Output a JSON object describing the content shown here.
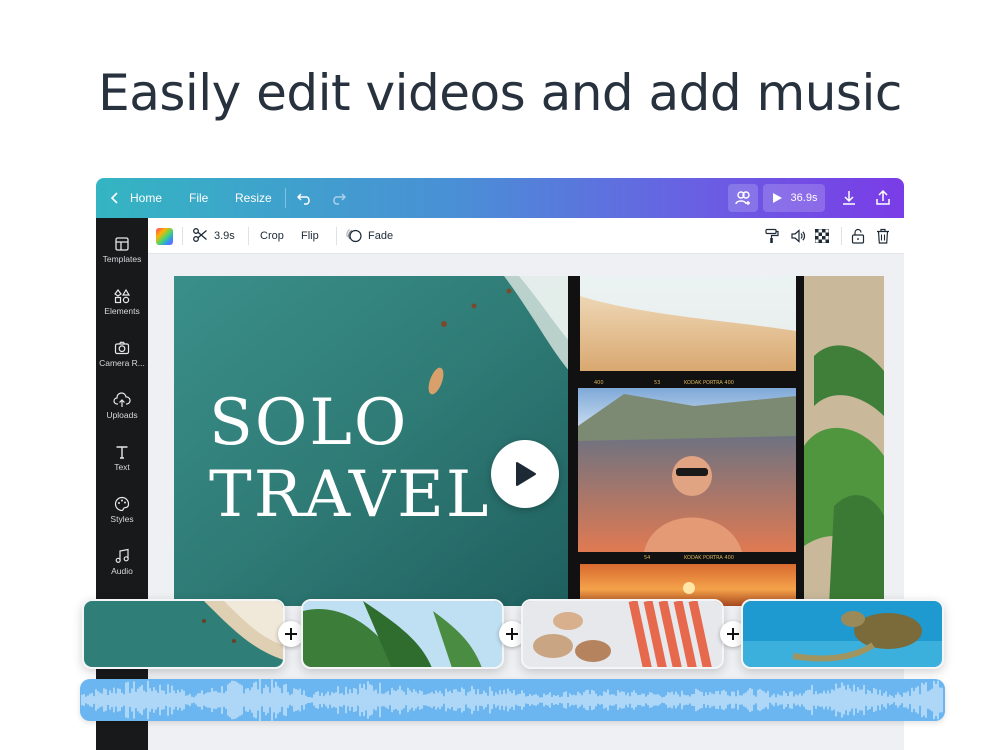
{
  "headline": "Easily edit videos and add music",
  "topbar": {
    "home_label": "Home",
    "file_label": "File",
    "resize_label": "Resize",
    "duration": "36.9s",
    "icons": [
      "chevron-left-icon",
      "undo-icon",
      "redo-icon",
      "share-people-icon",
      "play-icon",
      "download-icon",
      "upload-icon"
    ]
  },
  "sidebar": {
    "items": [
      {
        "label": "Templates",
        "icon": "templates-icon"
      },
      {
        "label": "Elements",
        "icon": "elements-icon"
      },
      {
        "label": "Camera R...",
        "icon": "camera-icon"
      },
      {
        "label": "Uploads",
        "icon": "upload-cloud-icon"
      },
      {
        "label": "Text",
        "icon": "text-icon"
      },
      {
        "label": "Styles",
        "icon": "palette-icon"
      },
      {
        "label": "Audio",
        "icon": "music-note-icon"
      }
    ]
  },
  "toolbar": {
    "clip_duration": "3.9s",
    "crop_label": "Crop",
    "flip_label": "Flip",
    "fade_label": "Fade",
    "icons": [
      "color-swatch-icon",
      "scissors-icon",
      "fade-icon",
      "paint-roller-icon",
      "volume-icon",
      "transparency-icon",
      "lock-icon",
      "trash-icon"
    ]
  },
  "canvas": {
    "title_line1": "SOLO",
    "title_line2": "TRAVEL",
    "film_label_1": "400",
    "film_label_2": "53",
    "film_label_3": "KODAK PORTRA 400",
    "film_label_4": "KODAK PORTRA 400",
    "film_label_5": "54"
  },
  "timeline": {
    "clips": [
      {
        "icon": "beach-aerial-thumbnail"
      },
      {
        "icon": "palm-trees-thumbnail"
      },
      {
        "icon": "seafood-thumbnail"
      },
      {
        "icon": "sea-turtle-thumbnail"
      }
    ],
    "add_icon": "plus-icon",
    "audio_icon": "audio-waveform"
  },
  "colors": {
    "topbar_start": "#34b5c2",
    "topbar_end": "#7a3ce6",
    "sidebar": "#18191b",
    "audio_track": "#6bb6f0"
  }
}
